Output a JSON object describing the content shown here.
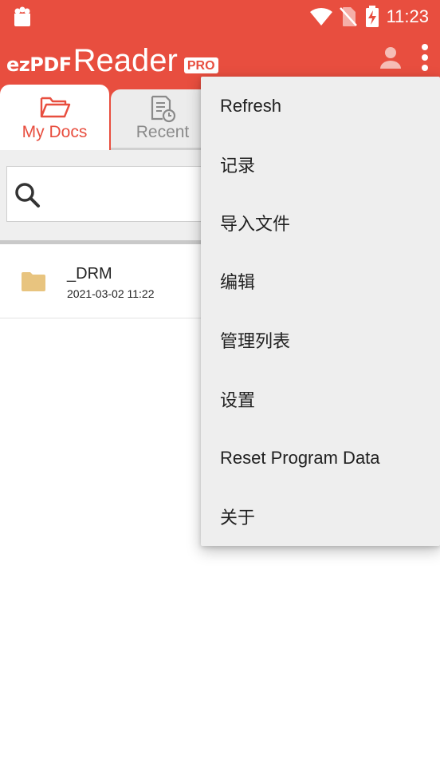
{
  "status_bar": {
    "time": "11:23",
    "colors": {
      "background": "#e84e3f"
    },
    "icons": [
      "notification-bag-icon",
      "wifi-icon",
      "no-sim-icon",
      "battery-charging-icon"
    ]
  },
  "header": {
    "logo_ez": "ezPDF",
    "logo_reader": "Reader",
    "logo_badge": "PRO",
    "accent_color": "#e84e3f",
    "icons": [
      "account-icon",
      "more-vert-icon"
    ]
  },
  "tabs": [
    {
      "label": "My Docs",
      "icon": "folder-open-icon",
      "selected": true
    },
    {
      "label": "Recent",
      "icon": "recent-document-icon",
      "selected": false
    }
  ],
  "search": {
    "placeholder": ""
  },
  "files": [
    {
      "name": "_DRM",
      "date": "2021-03-02 11:22",
      "icon": "folder-icon"
    }
  ],
  "menu": {
    "items": [
      {
        "label": "Refresh"
      },
      {
        "label": "记录"
      },
      {
        "label": "导入文件"
      },
      {
        "label": "编辑"
      },
      {
        "label": "管理列表"
      },
      {
        "label": "设置"
      },
      {
        "label": "Reset Program Data"
      },
      {
        "label": "关于"
      }
    ]
  }
}
